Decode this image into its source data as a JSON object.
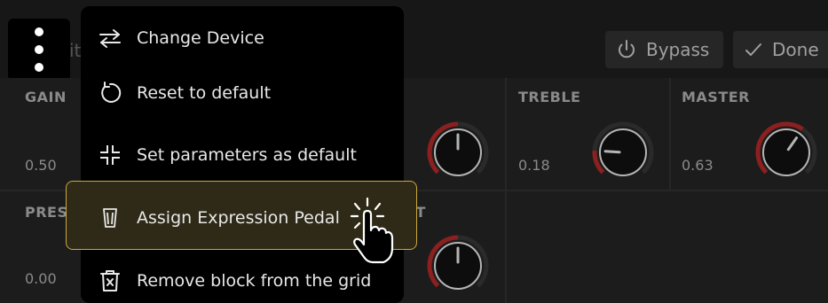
{
  "header": {
    "title_peek": "it",
    "bypass_label": "Bypass",
    "done_label": "Done"
  },
  "params": [
    {
      "label": "GAIN",
      "value": "0.50"
    },
    {
      "label": "TREBLE",
      "value": "0.18"
    },
    {
      "label": "MASTER",
      "value": "0.63"
    },
    {
      "label": "PRESE",
      "value": "0.00"
    },
    {
      "label": "UT",
      "value": ""
    }
  ],
  "knobs": {
    "gain": 0.5,
    "treble": 0.18,
    "master": 0.63,
    "output": 0.5
  },
  "menu": {
    "items": [
      {
        "label": "Change Device",
        "icon": "swap-arrows-icon"
      },
      {
        "label": "Reset to default",
        "icon": "reset-icon"
      },
      {
        "label": "Set parameters as default",
        "icon": "compress-icon"
      },
      {
        "label": "Assign Expression Pedal",
        "icon": "expression-pedal-icon"
      },
      {
        "label": "Remove block from the grid",
        "icon": "trash-icon"
      }
    ]
  },
  "colors": {
    "accent_red": "#8c1f1f",
    "highlight_border": "#c9a93c",
    "highlight_bg": "#2f2a17"
  }
}
